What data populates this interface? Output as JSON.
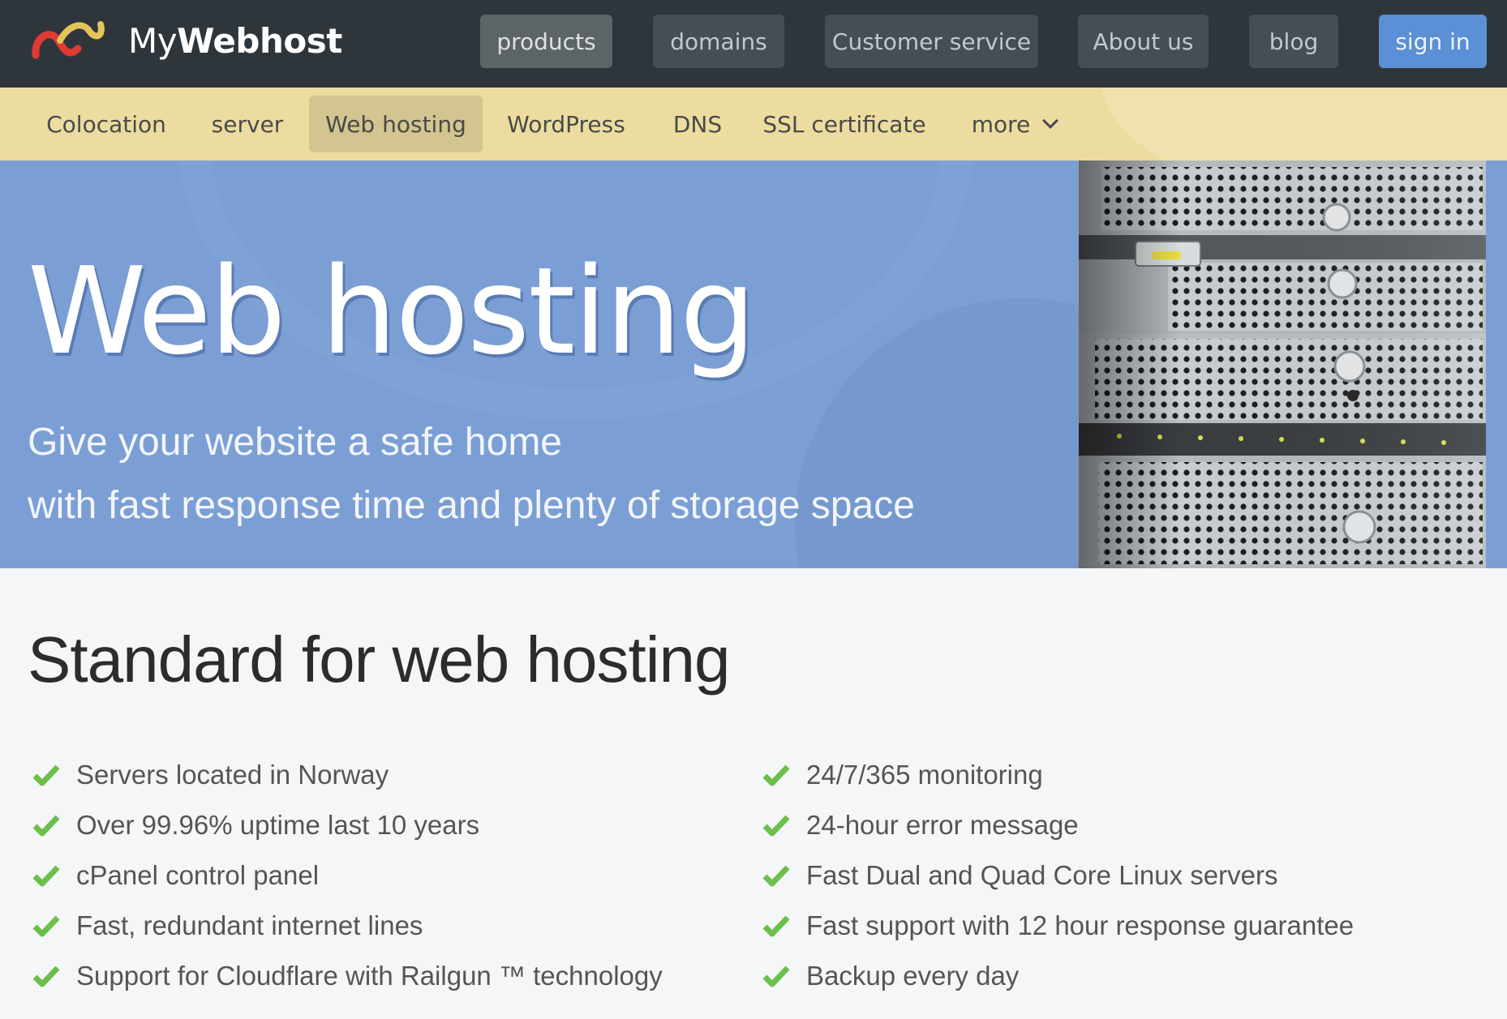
{
  "brand": {
    "prefix": "My",
    "name": "Webhost"
  },
  "topnav": {
    "items": [
      {
        "label": "products",
        "active": true
      },
      {
        "label": "domains"
      },
      {
        "label": "Customer service"
      },
      {
        "label": "About us"
      },
      {
        "label": "blog"
      }
    ],
    "signin_label": "sign in"
  },
  "subnav": {
    "items": [
      {
        "label": "Colocation"
      },
      {
        "label": "server"
      },
      {
        "label": "Web hosting",
        "active": true
      },
      {
        "label": "WordPress"
      },
      {
        "label": "DNS"
      },
      {
        "label": "SSL certificate"
      }
    ],
    "more_label": "more"
  },
  "hero": {
    "title": "Web hosting",
    "subtitle_line1": "Give your website a safe home",
    "subtitle_line2": "with fast response time and plenty of storage space"
  },
  "features": {
    "title": "Standard for web hosting",
    "left": [
      "Servers located in Norway",
      "Over 99.96% uptime last 10 years",
      "cPanel control panel",
      "Fast, redundant internet lines",
      "Support for Cloudflare with Railgun ™ technology"
    ],
    "right": [
      "24/7/365 monitoring",
      "24-hour error message",
      "Fast Dual and Quad Core Linux servers",
      "Fast support with 12 hour response guarantee",
      "Backup every day"
    ]
  },
  "colors": {
    "topbar": "#2f363b",
    "subnav": "#ecdca0",
    "hero": "#7b9fd4",
    "accent": "#5b8fd6",
    "check": "#6cbf4a"
  }
}
